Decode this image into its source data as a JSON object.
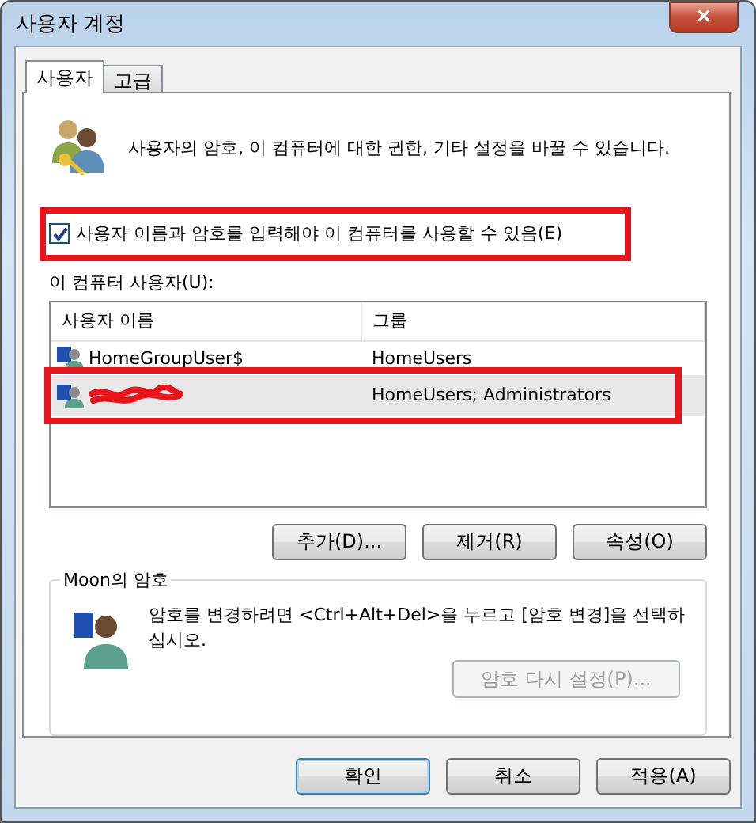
{
  "window": {
    "title": "사용자 계정",
    "close": "×"
  },
  "tabs": [
    {
      "label": "사용자",
      "selected": true
    },
    {
      "label": "고급",
      "selected": false
    }
  ],
  "intro": "사용자의 암호, 이 컴퓨터에 대한  권한, 기타 설정을 바꿀 수 있습니다.",
  "require_login": {
    "label": "사용자 이름과 암호를 입력해야 이 컴퓨터를 사용할 수 있음(E)",
    "checked": true,
    "highlighted": true
  },
  "users_label": "이 컴퓨터 사용자(U):",
  "table": {
    "columns": [
      "사용자 이름",
      "그룹"
    ],
    "rows": [
      {
        "name": "HomeGroupUser$",
        "group": "HomeUsers",
        "selected": false,
        "highlighted": false,
        "redacted": false
      },
      {
        "group": "HomeUsers; Administrators",
        "selected": true,
        "highlighted": true,
        "redacted": true
      }
    ]
  },
  "list_buttons": [
    "추가(D)...",
    "제거(R)",
    "속성(O)"
  ],
  "password_group": {
    "title": "Moon의 암호",
    "text": "암호를 변경하려면 <Ctrl+Alt+Del>을 누르고 [암호 변경]을 선택하십시오.",
    "button": {
      "label": "암호 다시 설정(P)...",
      "disabled": true
    }
  },
  "buttons": [
    {
      "label": "확인",
      "default": true
    },
    {
      "label": "취소",
      "default": false
    },
    {
      "label": "적용(A)",
      "default": false
    }
  ]
}
